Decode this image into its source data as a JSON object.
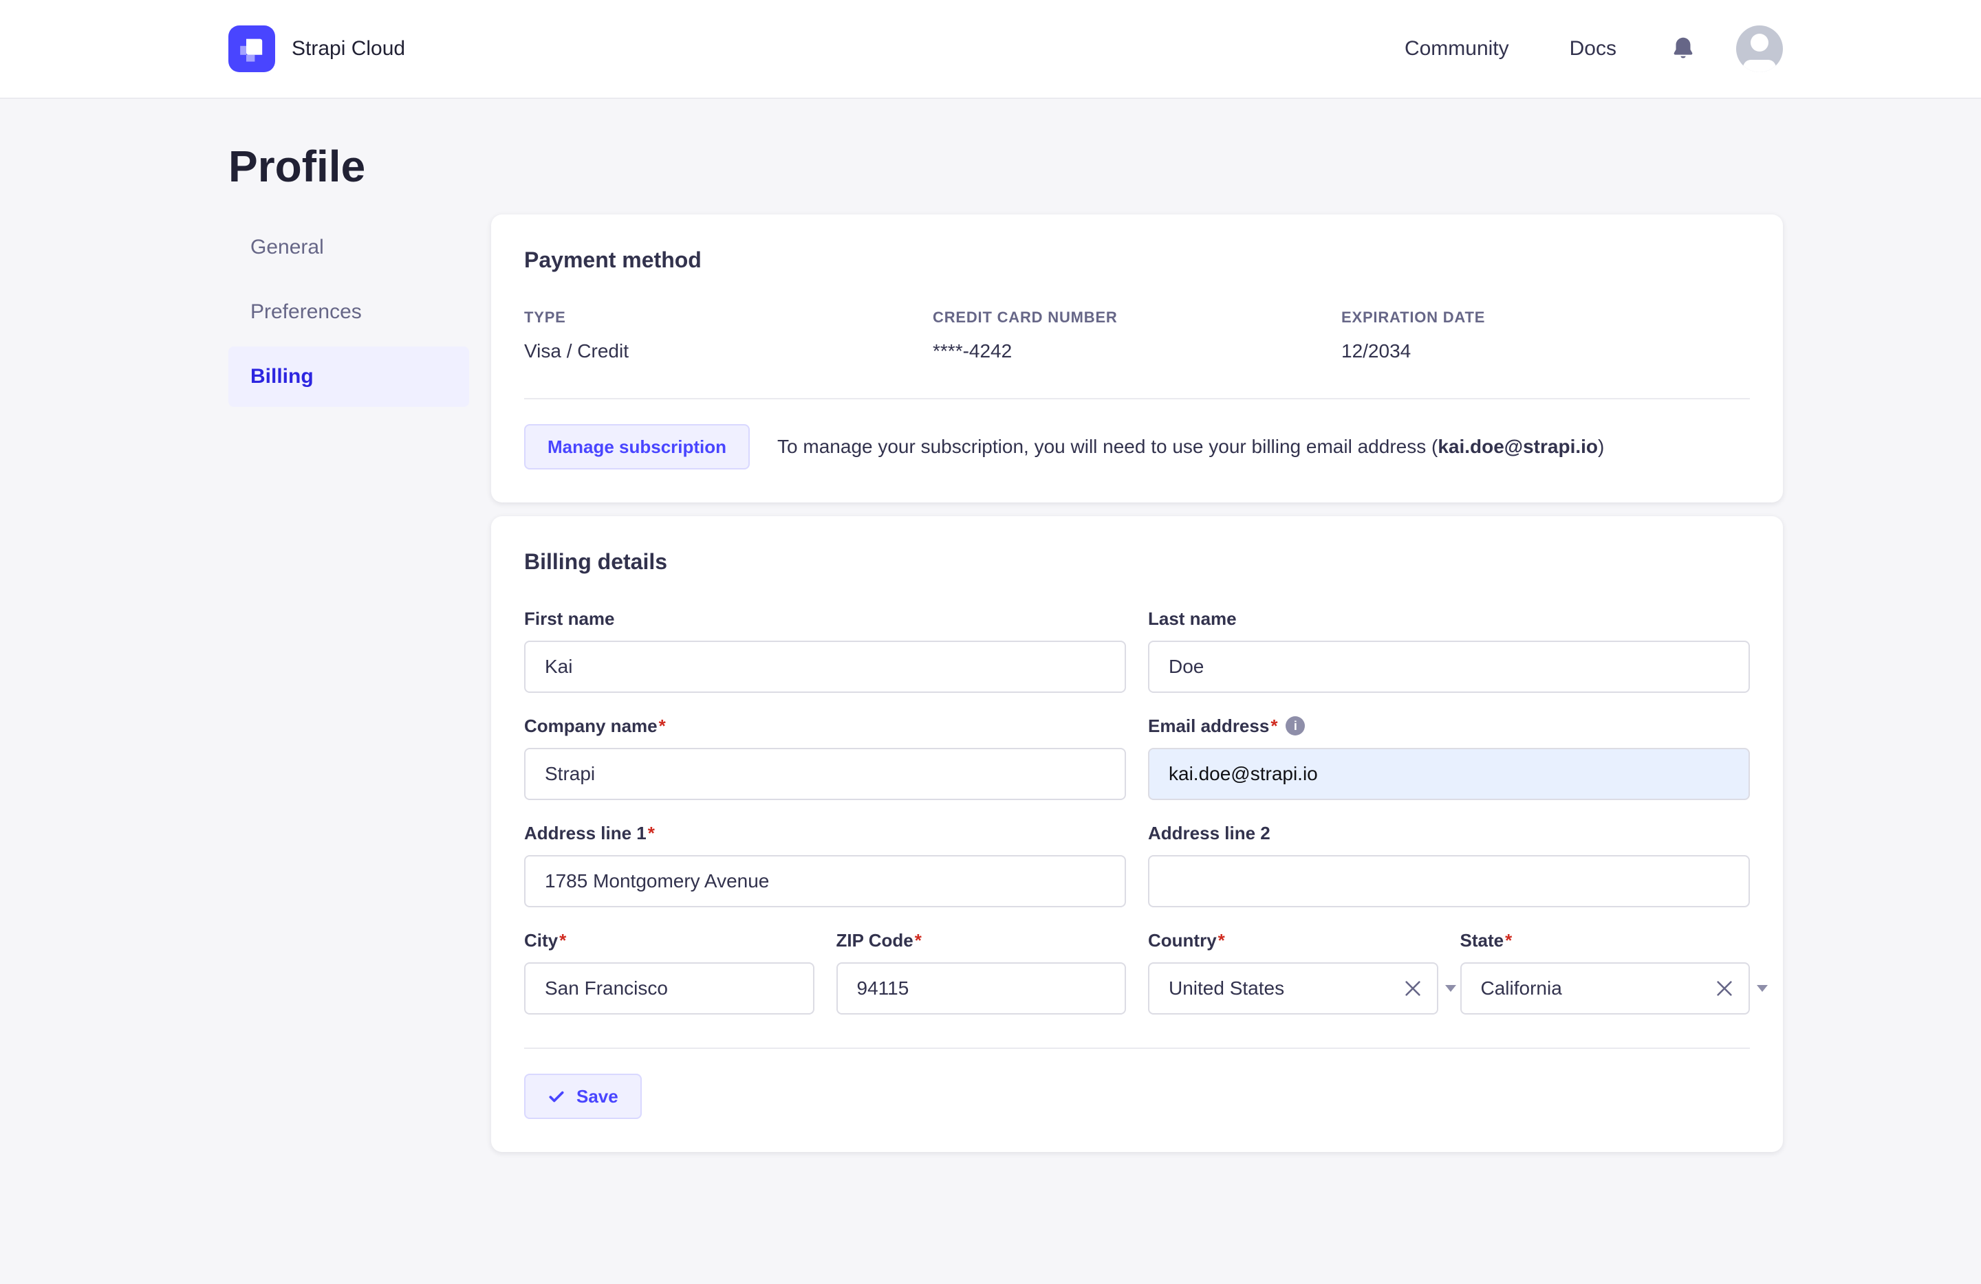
{
  "header": {
    "brand": "Strapi Cloud",
    "nav": [
      {
        "label": "Community"
      },
      {
        "label": "Docs"
      }
    ],
    "icons": {
      "bell": "bell-icon",
      "avatar": "user-avatar"
    }
  },
  "page": {
    "title": "Profile"
  },
  "sidebar": {
    "items": [
      {
        "label": "General",
        "active": false
      },
      {
        "label": "Preferences",
        "active": false
      },
      {
        "label": "Billing",
        "active": true
      }
    ]
  },
  "payment_method": {
    "title": "Payment method",
    "fields": [
      {
        "label": "TYPE",
        "value": "Visa / Credit"
      },
      {
        "label": "CREDIT CARD NUMBER",
        "value": "****-4242"
      },
      {
        "label": "EXPIRATION DATE",
        "value": "12/2034"
      }
    ],
    "manage_button": "Manage subscription",
    "note_prefix": "To manage your subscription, you will need to use your billing email address (",
    "note_email": "kai.doe@strapi.io",
    "note_suffix": ")"
  },
  "billing_details": {
    "title": "Billing details",
    "fields": {
      "first_name": {
        "label": "First name",
        "value": "Kai"
      },
      "last_name": {
        "label": "Last name",
        "value": "Doe"
      },
      "company": {
        "label": "Company name",
        "value": "Strapi"
      },
      "email": {
        "label": "Email address",
        "value": "kai.doe@strapi.io"
      },
      "address1": {
        "label": "Address line 1",
        "value": "1785 Montgomery Avenue"
      },
      "address2": {
        "label": "Address line 2",
        "value": ""
      },
      "city": {
        "label": "City",
        "value": "San Francisco"
      },
      "zip": {
        "label": "ZIP Code",
        "value": "94115"
      },
      "country": {
        "label": "Country",
        "value": "United States"
      },
      "state": {
        "label": "State",
        "value": "California"
      }
    },
    "save_button": "Save"
  },
  "ui": {
    "required_marker": "*",
    "info_glyph": "i"
  },
  "colors": {
    "primary": "#4945ff",
    "primary_active_link": "#2d26e0",
    "light_purple_bg": "#f0f0ff",
    "button_border": "#d9d8ff",
    "page_bg": "#f6f6f9",
    "card_bg": "#ffffff",
    "divider": "#eaeaef",
    "input_border": "#dcdce4",
    "text_dark": "#32324d",
    "text_muted": "#666687",
    "required_red": "#d02b20",
    "autofill_blue": "#e8f0fe",
    "avatar_gray": "#c3c7d3"
  }
}
